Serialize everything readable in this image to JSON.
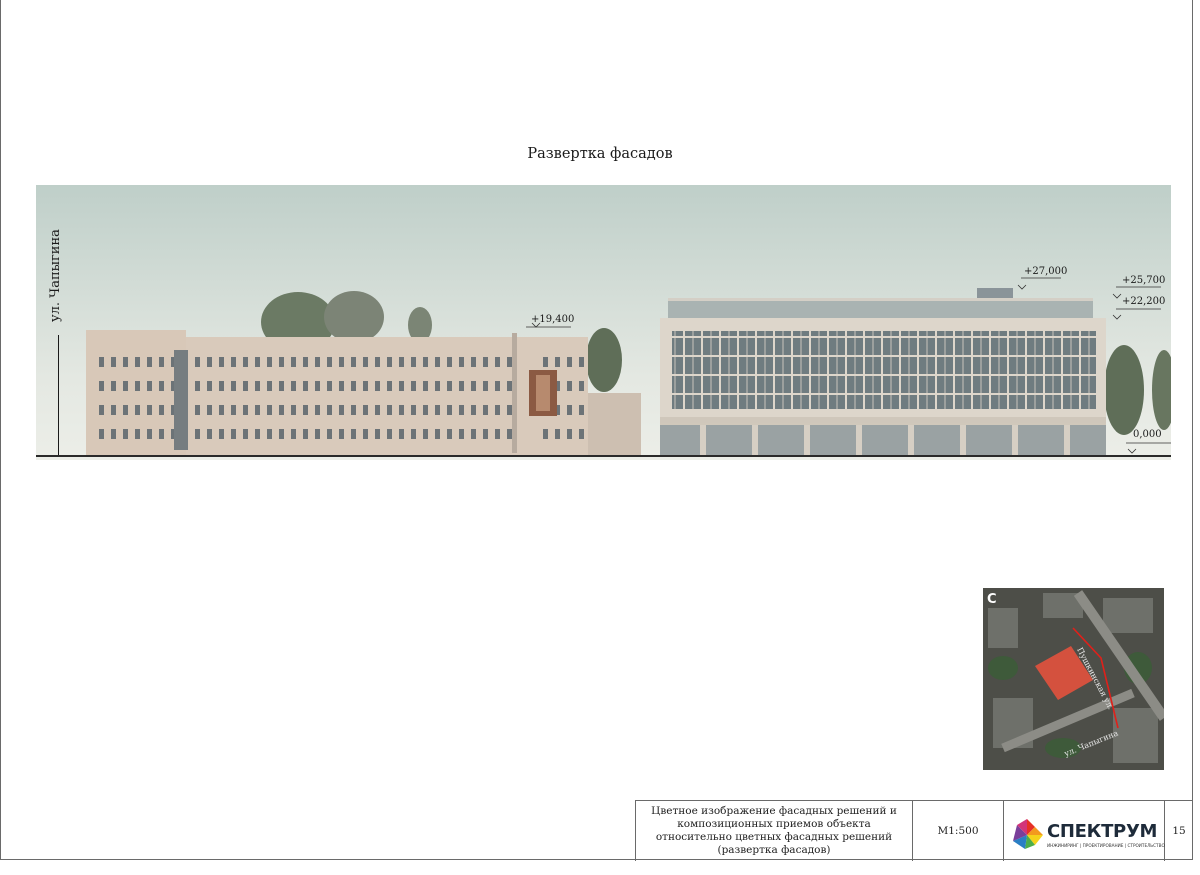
{
  "sheet": {
    "title": "Развертка фасадов",
    "street_label": "ул. Чапыгина"
  },
  "elevations": {
    "left_building_top": "+19,400",
    "right_top": "+27,000",
    "right_parapet_upper": "+25,700",
    "right_parapet_lower": "+22,200",
    "ground": "0,000"
  },
  "map": {
    "north": "С",
    "street_vertical": "Пушкинская ул.",
    "street_bottom": "ул. Чапыгина"
  },
  "title_block": {
    "description": "Цветное изображение фасадных решений и композиционных приемов объекта относительно цветных фасадных решений (развертка фасадов)",
    "scale": "М1:500",
    "company": "СПЕКТРУМ",
    "company_tagline": "ИНЖИНИРИНГ | ПРОЕКТИРОВАНИЕ | СТРОИТЕЛЬСТВО",
    "sheet_number": "15",
    "colors": {
      "logo_red": "#e63027",
      "logo_orange": "#f39a1e",
      "logo_yellow": "#f5d31b",
      "logo_green": "#4cae4a",
      "logo_blue": "#2a7fc4",
      "logo_purple": "#7a3f9a"
    }
  }
}
